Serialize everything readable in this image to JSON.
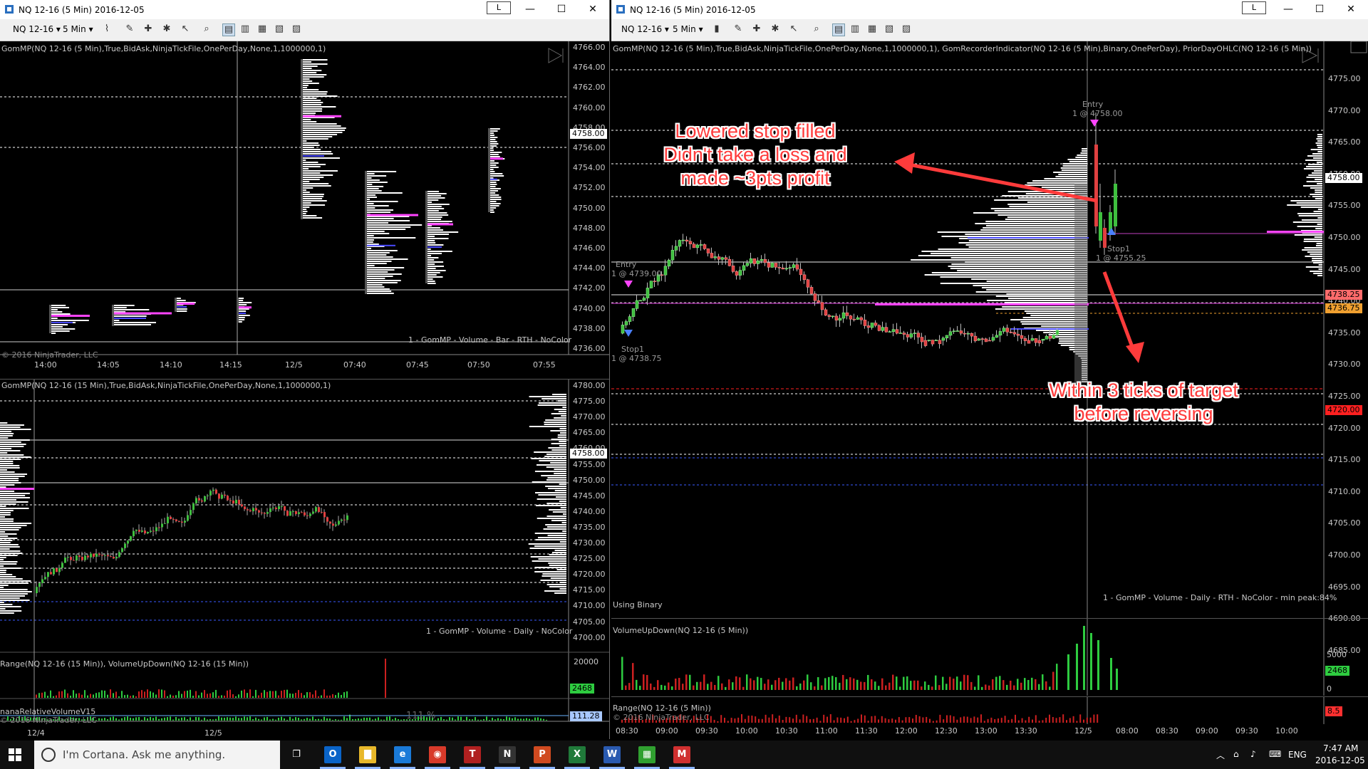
{
  "left_window": {
    "title": "NQ 12-16 (5 Min)  2016-12-05",
    "toolbar": {
      "instrument": "NQ 12-16",
      "interval": "5 Min"
    },
    "lock_button": "L",
    "top_chart": {
      "indicator_label": "GomMP(NQ 12-16 (5 Min),True,BidAsk,NinjaTickFile,OnePerDay,None,1,1000000,1)",
      "footer_label": "1 - GomMP  - Volume - Bar - RTH - NoColor",
      "copyright": "© 2016 NinjaTrader, LLC",
      "price_tag": "4758.00",
      "y_ticks": [
        "4766.00",
        "4764.00",
        "4762.00",
        "4760.00",
        "4758.00",
        "4756.00",
        "4754.00",
        "4752.00",
        "4750.00",
        "4748.00",
        "4746.00",
        "4744.00",
        "4742.00",
        "4740.00",
        "4738.00",
        "4736.00"
      ],
      "x_ticks": [
        "14:00",
        "14:05",
        "14:10",
        "14:15",
        "12/5",
        "07:40",
        "07:45",
        "07:50",
        "07:55"
      ]
    },
    "bottom_chart": {
      "indicator_label": "GomMP(NQ 12-16 (15 Min),True,BidAsk,NinjaTickFile,OnePerDay,None,1,1000000,1)",
      "footer_label": "1 - GomMP  - Volume - Daily - NoColor",
      "price_tag": "4758.00",
      "y_ticks": [
        "4780.00",
        "4775.00",
        "4770.00",
        "4765.00",
        "4760.00",
        "4755.00",
        "4750.00",
        "4745.00",
        "4740.00",
        "4735.00",
        "4730.00",
        "4725.00",
        "4720.00",
        "4715.00",
        "4710.00",
        "4705.00",
        "4700.00"
      ],
      "volume_label": "Range(NQ 12-16 (15 Min)), VolumeUpDown(NQ 12-16 (15 Min))",
      "volume_tick": "20000",
      "volume_tag": "2468",
      "rel_label": "nanaRelativeVolumeV15",
      "rel_copyright": "© 2016 NinjaTrader, LLC",
      "rel_value": "111 %",
      "rel_tag": "111.28",
      "x_ticks": [
        "12/4",
        "12/5"
      ]
    }
  },
  "right_window": {
    "title": "NQ 12-16 (5 Min)  2016-12-05",
    "toolbar": {
      "instrument": "NQ 12-16",
      "interval": "5 Min"
    },
    "lock_button": "L",
    "main_chart": {
      "indicator_label": "GomMP(NQ 12-16 (5 Min),True,BidAsk,NinjaTickFile,OnePerDay,None,1,1000000,1), GomRecorderIndicator(NQ 12-16 (5 Min),Binary,OnePerDay), PriorDayOHLC(NQ 12-16 (5 Min))",
      "footer_label": "1 - GomMP  - Volume - Daily - RTH - NoColor - min peak:84%",
      "using_label": "Using Binary",
      "y_ticks": [
        "4775.00",
        "4770.00",
        "4765.00",
        "4760.00",
        "4755.00",
        "4750.00",
        "4745.00",
        "4740.00",
        "4735.00",
        "4730.00",
        "4725.00",
        "4720.00",
        "4715.00",
        "4710.00",
        "4705.00",
        "4700.00",
        "4695.00",
        "4690.00",
        "4685.00"
      ],
      "price_tags": [
        {
          "text": "4758.00",
          "color": "#ffffff"
        },
        {
          "text": "4738.25",
          "color": "#ff6b6b"
        },
        {
          "text": "4736.75",
          "color": "#f0a030"
        },
        {
          "text": "4720.00",
          "color": "#ff2020"
        }
      ],
      "trade_marks": {
        "entry_left": "Entry",
        "entry_left_price": "1 @ 4739.00",
        "stop_left": "Stop1",
        "stop_left_price": "1 @ 4738.75",
        "entry_right": "Entry",
        "entry_right_price": "1 @ 4758.00",
        "stop_right": "Stop1",
        "stop_right_price": "1 @ 4755.25"
      }
    },
    "volume_chart": {
      "label": "VolumeUpDown(NQ 12-16 (5 Min))",
      "y_ticks": [
        "5000",
        "2500",
        "0"
      ],
      "tag": "2468"
    },
    "range_chart": {
      "label": "Range(NQ 12-16 (5 Min))",
      "copyright": "© 2016 NinjaTrader, LLC",
      "tag": "8.5"
    },
    "x_ticks": [
      "08:30",
      "09:00",
      "09:30",
      "10:00",
      "10:30",
      "11:00",
      "11:30",
      "12:00",
      "12:30",
      "13:00",
      "13:30",
      "12/5",
      "08:00",
      "08:30",
      "09:00",
      "09:30",
      "10:00"
    ]
  },
  "annotations": {
    "top": [
      "Lowered stop filled",
      "Didn't take a loss and",
      "made ~3pts profit"
    ],
    "bottom": [
      "Within 3 ticks of target",
      "before reversing"
    ],
    "color": "#ff3b3b"
  },
  "taskbar": {
    "search_placeholder": "I'm Cortana. Ask me anything.",
    "apps": [
      "outlook-icon",
      "explorer-icon",
      "edge-icon",
      "chrome-icon",
      "tws-icon",
      "ninjatrader-icon",
      "powerpoint-icon",
      "excel-icon",
      "word-icon",
      "calculator-icon",
      "gmail-icon"
    ],
    "language": "ENG",
    "time": "7:47 AM",
    "date": "2016-12-05"
  }
}
